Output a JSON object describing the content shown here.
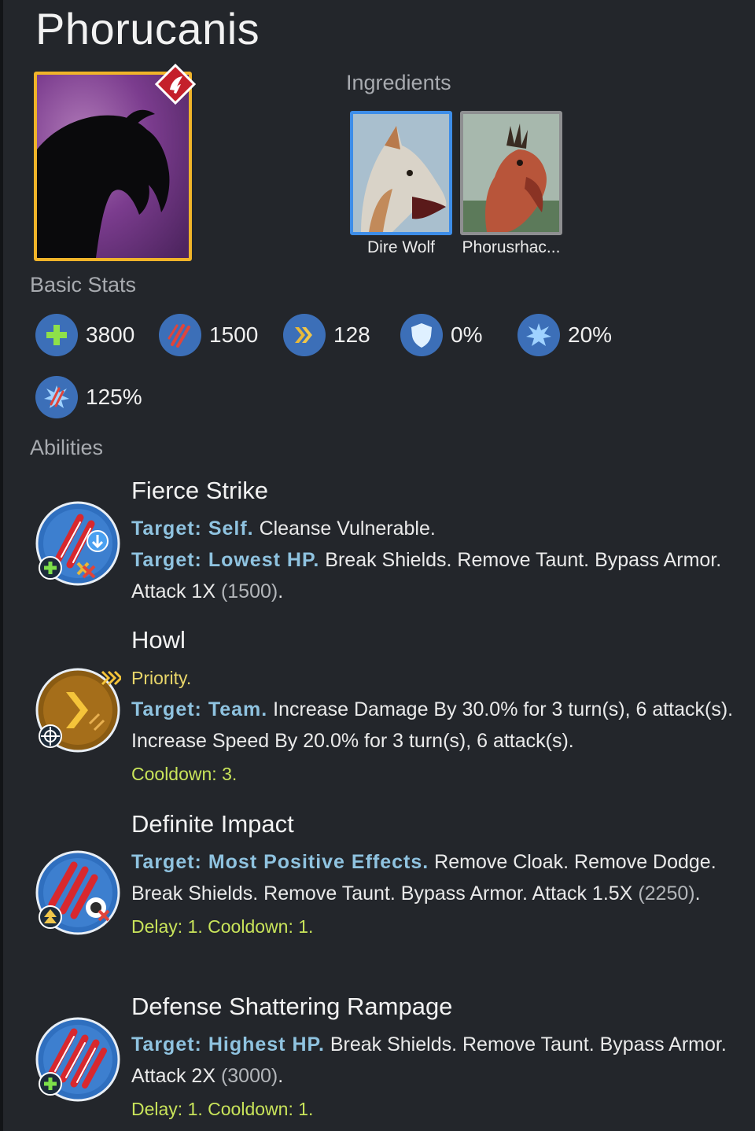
{
  "title": "Phorucanis",
  "colors": {
    "background": "#23262b",
    "portrait_border": "#f0b429",
    "target_text": "#8fc3e0",
    "cooldown_text": "#c9e45a",
    "priority_text": "#e9d66a",
    "stat_icon_bg": "#3c6fb8"
  },
  "ingredients": {
    "label": "Ingredients",
    "items": [
      {
        "name": "Dire Wolf"
      },
      {
        "name": "Phorusrhac..."
      }
    ]
  },
  "basic_stats": {
    "label": "Basic Stats",
    "items": [
      {
        "icon": "health-icon",
        "value": "3800"
      },
      {
        "icon": "damage-icon",
        "value": "1500"
      },
      {
        "icon": "speed-icon",
        "value": "128"
      },
      {
        "icon": "armor-icon",
        "value": "0%"
      },
      {
        "icon": "critical-chance-icon",
        "value": "20%"
      },
      {
        "icon": "critical-damage-icon",
        "value": "125%"
      }
    ]
  },
  "abilities": {
    "label": "Abilities",
    "items": [
      {
        "name": "Fierce Strike",
        "t1_target": "Target: Self.",
        "t1_text": " Cleanse Vulnerable.",
        "t2_target": "Target: Lowest HP.",
        "t2_text": " Break Shields. Remove Taunt. Bypass Armor. Attack 1X ",
        "t2_num": "(1500)",
        "t2_end": "."
      },
      {
        "name": "Howl",
        "priority": "Priority.",
        "t1_target": "Target: Team.",
        "t1_text": " Increase Damage By 30.0% for 3 turn(s), 6 attack(s). Increase Speed By 20.0% for 3 turn(s), 6 attack(s).",
        "cooldown": "Cooldown: 3."
      },
      {
        "name": "Definite Impact",
        "t1_target": "Target: Most Positive Effects.",
        "t1_text": " Remove Cloak. Remove Dodge. Break Shields. Remove Taunt. Bypass Armor. Attack 1.5X ",
        "t1_num": "(2250)",
        "t1_end": ".",
        "cooldown": "Delay: 1. Cooldown: 1."
      },
      {
        "name": "Defense Shattering Rampage",
        "t1_target": "Target: Highest HP.",
        "t1_text": " Break Shields. Remove Taunt. Bypass Armor. Attack 2X ",
        "t1_num": "(3000)",
        "t1_end": ".",
        "cooldown": "Delay: 1. Cooldown: 1."
      }
    ]
  }
}
